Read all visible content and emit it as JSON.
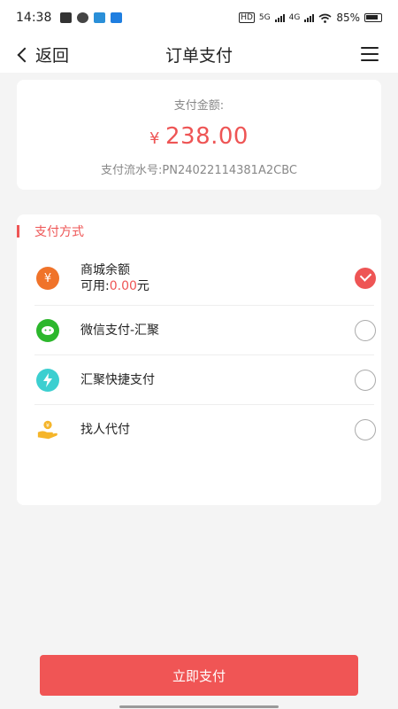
{
  "status_bar": {
    "time": "14:38",
    "battery": "85%",
    "network_1": "5G",
    "network_2": "4G",
    "hd_label": "HD"
  },
  "nav": {
    "back_label": "返回",
    "title": "订单支付"
  },
  "payment": {
    "amount_label": "支付金额:",
    "currency_symbol": "¥",
    "amount": "238.00",
    "serial_text": "支付流水号:PN24022114381A2CBC"
  },
  "methods": {
    "title": "支付方式",
    "items": [
      {
        "label": "商城余额",
        "sub_prefix": "可用:",
        "sub_value": "0.00",
        "sub_suffix": "元",
        "icon": "yen-circle-icon",
        "selected": true
      },
      {
        "label": "微信支付-汇聚",
        "icon": "wechat-icon",
        "selected": false
      },
      {
        "label": "汇聚快捷支付",
        "icon": "lightning-icon",
        "selected": false
      },
      {
        "label": "找人代付",
        "icon": "hand-coin-icon",
        "selected": false
      }
    ]
  },
  "pay_button": "立即支付",
  "colors": {
    "accent": "#e55555",
    "button": "#f05555"
  }
}
